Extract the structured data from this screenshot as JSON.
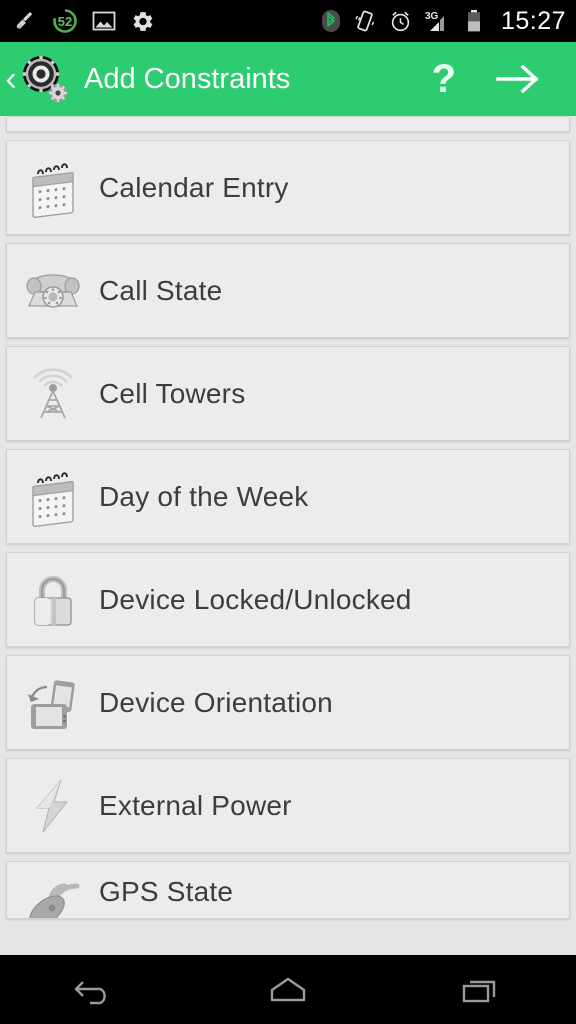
{
  "statusbar": {
    "time": "15:27",
    "left_icons": [
      {
        "name": "broom-cleaner-icon",
        "label": "Cleaner"
      },
      {
        "name": "battery-percent-badge-icon",
        "label": "52"
      },
      {
        "name": "image-gallery-icon",
        "label": "Screenshot"
      },
      {
        "name": "gear-settings-icon",
        "label": "Settings"
      }
    ],
    "right_icons": [
      {
        "name": "bluetooth-icon",
        "label": "Bluetooth"
      },
      {
        "name": "vibrate-mode-icon",
        "label": "Vibrate"
      },
      {
        "name": "alarm-clock-icon",
        "label": "Alarm"
      },
      {
        "name": "signal-3g-icon",
        "label": "3G"
      },
      {
        "name": "battery-icon",
        "label": "Battery"
      }
    ],
    "signal_label": "3G",
    "badge_value": "52"
  },
  "appbar": {
    "title": "Add Constraints",
    "back_glyph": "‹",
    "help_label": "?",
    "next_label": "→",
    "app_icon_name": "gears-app-icon",
    "background_color": "#2ecc71",
    "title_color": "#ffffff"
  },
  "list": {
    "partial_row_above": true,
    "items": [
      {
        "label": "Calendar Entry",
        "icon": "calendar-icon"
      },
      {
        "label": "Call State",
        "icon": "telephone-icon"
      },
      {
        "label": "Cell Towers",
        "icon": "cell-tower-icon"
      },
      {
        "label": "Day of the Week",
        "icon": "calendar-icon"
      },
      {
        "label": "Device Locked/Unlocked",
        "icon": "padlock-icon"
      },
      {
        "label": "Device Orientation",
        "icon": "device-rotation-icon"
      },
      {
        "label": "External Power",
        "icon": "lightning-bolt-icon"
      },
      {
        "label": "GPS State",
        "icon": "satellite-dish-icon"
      }
    ],
    "row_background": "#ececec",
    "text_color": "#3d3d3d"
  },
  "navbar": {
    "buttons": [
      {
        "name": "nav-back-button",
        "label": "Back"
      },
      {
        "name": "nav-home-button",
        "label": "Home"
      },
      {
        "name": "nav-recents-button",
        "label": "Recents"
      }
    ]
  }
}
